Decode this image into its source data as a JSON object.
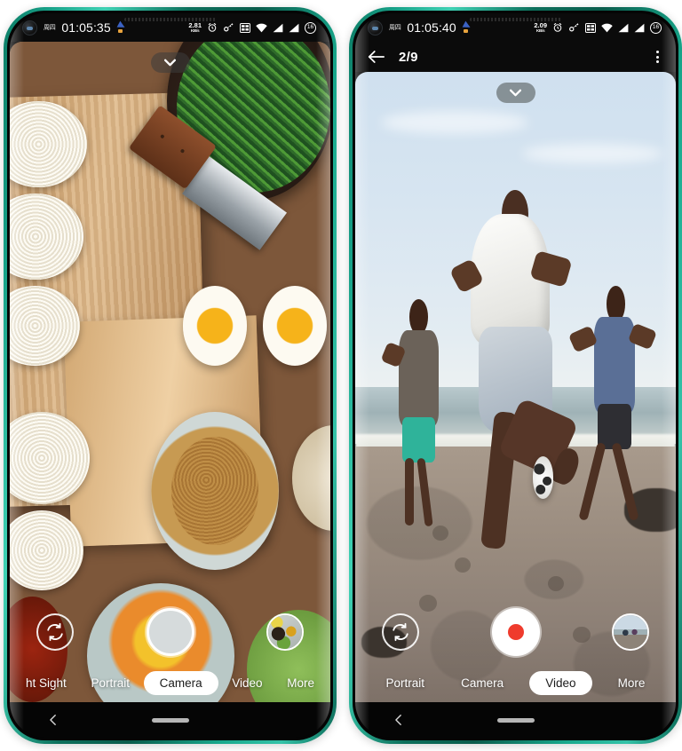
{
  "phones": [
    {
      "id": "left",
      "status_bar": {
        "day": "周四",
        "time": "01:05:35",
        "net_speed_value": "2.81",
        "net_speed_unit": "KB/s",
        "icons": [
          "camera-punchhole",
          "app-icon",
          "alarm-icon",
          "key-icon",
          "volte-icon",
          "wifi-icon",
          "signal-icon-1",
          "signal-icon-2"
        ],
        "battery_level": "16"
      },
      "app_bar": null,
      "viewfinder": {
        "scene": "food-flatlay",
        "dropdown_icon": "chevron-down-icon"
      },
      "controls": {
        "flip_icon": "camera-flip-icon",
        "shutter_type": "photo",
        "thumbnail": "food-thumbnail"
      },
      "modes": [
        {
          "label": "ht Sight",
          "active": false
        },
        {
          "label": "Portrait",
          "active": false
        },
        {
          "label": "Camera",
          "active": true
        },
        {
          "label": "Video",
          "active": false
        },
        {
          "label": "More",
          "active": false
        }
      ],
      "nav_bar": {
        "back_icon": "back-chevron-icon",
        "home_indicator": "home-pill"
      }
    },
    {
      "id": "right",
      "status_bar": {
        "day": "周四",
        "time": "01:05:40",
        "net_speed_value": "2.09",
        "net_speed_unit": "KB/s",
        "icons": [
          "camera-punchhole",
          "app-icon",
          "alarm-icon",
          "key-icon",
          "volte-icon",
          "wifi-icon",
          "signal-icon-1",
          "signal-icon-2"
        ],
        "battery_level": "16"
      },
      "app_bar": {
        "back_icon": "back-arrow-icon",
        "title": "2/9",
        "menu_icon": "kebab-menu-icon"
      },
      "viewfinder": {
        "scene": "beach-football",
        "dropdown_icon": "chevron-down-icon"
      },
      "controls": {
        "flip_icon": "camera-flip-icon",
        "shutter_type": "video",
        "thumbnail": "beach-thumbnail"
      },
      "modes": [
        {
          "label": "Portrait",
          "active": false
        },
        {
          "label": "Camera",
          "active": false
        },
        {
          "label": "Video",
          "active": true
        },
        {
          "label": "More",
          "active": false
        }
      ],
      "nav_bar": {
        "back_icon": "back-chevron-icon",
        "home_indicator": "home-pill"
      }
    }
  ],
  "colors": {
    "frame_teal": "#17a188",
    "record_red": "#ef3b2d",
    "active_pill": "#ffffff",
    "status_bg": "#0b0b0b"
  }
}
